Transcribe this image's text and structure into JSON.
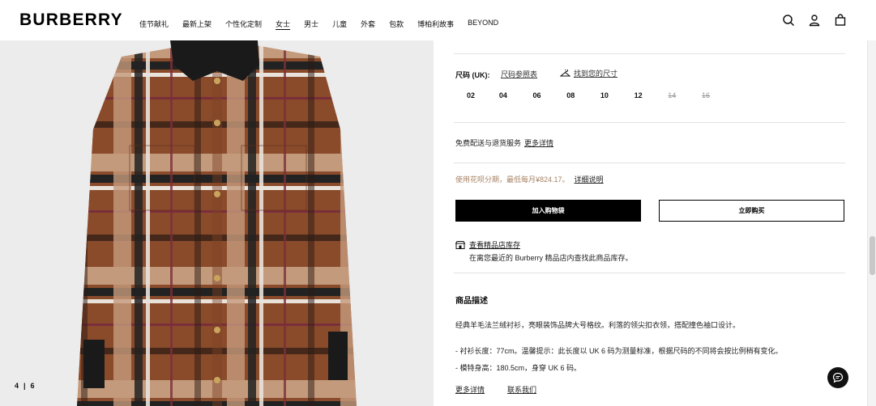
{
  "header": {
    "logo": "BURBERRY",
    "nav": [
      {
        "label": "佳节献礼",
        "active": false
      },
      {
        "label": "最新上架",
        "active": false
      },
      {
        "label": "个性化定制",
        "active": false
      },
      {
        "label": "女士",
        "active": true
      },
      {
        "label": "男士",
        "active": false
      },
      {
        "label": "儿童",
        "active": false
      },
      {
        "label": "外套",
        "active": false
      },
      {
        "label": "包款",
        "active": false
      },
      {
        "label": "博柏利故事",
        "active": false
      },
      {
        "label": "BEYOND",
        "active": false
      }
    ],
    "icons": [
      "search-icon",
      "account-icon",
      "bag-icon"
    ]
  },
  "gallery": {
    "current": "4",
    "separator": "|",
    "total": "6"
  },
  "product": {
    "size_label": "尺码 (UK):",
    "size_guide": "尺码参照表",
    "find_size": "找到您的尺寸",
    "sizes": [
      {
        "label": "02",
        "available": true
      },
      {
        "label": "04",
        "available": true
      },
      {
        "label": "06",
        "available": true
      },
      {
        "label": "08",
        "available": true
      },
      {
        "label": "10",
        "available": true
      },
      {
        "label": "12",
        "available": true
      },
      {
        "label": "14",
        "available": false
      },
      {
        "label": "16",
        "available": false
      }
    ],
    "delivery_text": "免费配送与退货服务",
    "delivery_link": "更多详情",
    "installment_text": "使用花呗分期，最低每月¥824.17。",
    "installment_link": "详细说明",
    "add_to_bag": "加入购物袋",
    "buy_now": "立即购买",
    "store_title": "查看精品店库存",
    "store_desc": "在离您最近的 Burberry 精品店内查找此商品库存。",
    "desc_title": "商品描述",
    "desc_text": "经典羊毛法兰绒衬衫，亮眼装饰品牌大号格纹。利落的领尖扣衣领，搭配撞色袖口设计。",
    "desc_bullet1": "- 衬衫长度：77cm。温馨提示：此长度以 UK 6 码为测量标准，根据尺码的不同将会按比例稍有变化。",
    "desc_bullet2": "- 模特身高：180.5cm，身穿 UK 6 码。",
    "more_details": "更多详情",
    "contact_us": "联系我们"
  },
  "colors": {
    "installment": "#a78365",
    "button_dark": "#000000",
    "shirt_brown": "#8a4b2b"
  }
}
